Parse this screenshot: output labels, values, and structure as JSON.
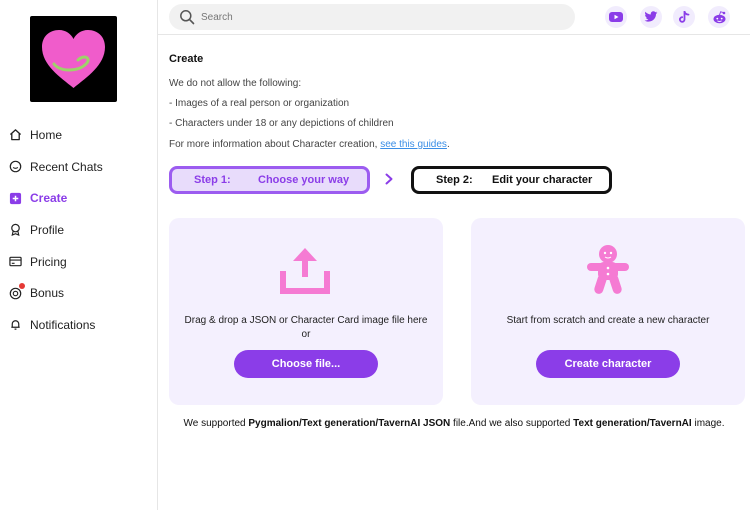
{
  "sidebar": {
    "items": [
      {
        "label": "Home",
        "icon": "home-icon"
      },
      {
        "label": "Recent Chats",
        "icon": "chat-icon"
      },
      {
        "label": "Create",
        "icon": "plus-square-icon",
        "active": true
      },
      {
        "label": "Profile",
        "icon": "badge-icon"
      },
      {
        "label": "Pricing",
        "icon": "card-icon"
      },
      {
        "label": "Bonus",
        "icon": "coin-icon",
        "notification_dot": true
      },
      {
        "label": "Notifications",
        "icon": "bell-icon"
      }
    ]
  },
  "search": {
    "placeholder": "Search"
  },
  "social": [
    "youtube-icon",
    "twitter-icon",
    "tiktok-icon",
    "reddit-icon"
  ],
  "page": {
    "title": "Create",
    "rules_intro": "We do not allow the following:",
    "rule_1": "- Images of a real person or organization",
    "rule_2": "- Characters under 18 or any depictions of children",
    "more_info": "For more information about Character creation,",
    "more_info_link": "see this guides",
    "more_info_end": "."
  },
  "steps": {
    "step1_num": "Step 1:",
    "step1_label": "Choose your way",
    "step2_num": "Step 2:",
    "step2_label": "Edit your character"
  },
  "upload_card": {
    "text": "Drag & drop a JSON or Character Card image file here",
    "or": "or",
    "button": "Choose file..."
  },
  "scratch_card": {
    "text": "Start from scratch and create a new character",
    "button": "Create character"
  },
  "footnote": {
    "p1": "We supported ",
    "b1": "Pygmalion/Text generation/TavernAI JSON",
    "p2": " file.And we also supported ",
    "b2": "Text generation/TavernAI",
    "p3": " image."
  },
  "colors": {
    "accent": "#8b3de8",
    "pink": "#f57bd3",
    "card_bg": "#f4f0fe"
  }
}
